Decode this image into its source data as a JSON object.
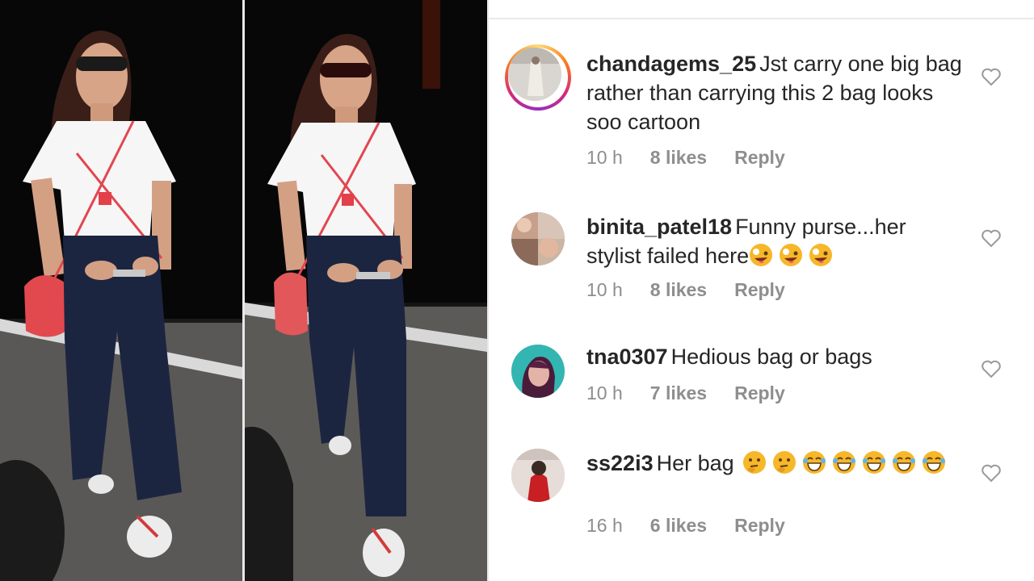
{
  "comments": [
    {
      "username": "chandagems_25",
      "text": "Jst carry one big bag rather than carrying this 2 bag looks soo cartoon",
      "emoji": [],
      "time": "10 h",
      "likes": "8 likes",
      "reply": "Reply",
      "has_story_ring": true,
      "avatar_icon": "user-avatar"
    },
    {
      "username": "binita_patel18",
      "text": "Funny purse...her stylist failed here",
      "emoji": [
        "zany-face",
        "zany-face",
        "zany-face"
      ],
      "time": "10 h",
      "likes": "8 likes",
      "reply": "Reply",
      "has_story_ring": false,
      "avatar_icon": "user-avatar"
    },
    {
      "username": "tna0307",
      "text": "Hedious bag or bags",
      "emoji": [],
      "time": "10 h",
      "likes": "7 likes",
      "reply": "Reply",
      "has_story_ring": false,
      "avatar_icon": "user-avatar"
    },
    {
      "username": "ss22i3",
      "text": "Her bag",
      "emoji": [
        "thinking-face",
        "thinking-face",
        "laughing-face",
        "laughing-face",
        "laughing-face",
        "laughing-face",
        "laughing-face"
      ],
      "time": "16 h",
      "likes": "6 likes",
      "reply": "Reply",
      "has_story_ring": false,
      "avatar_icon": "user-avatar"
    }
  ],
  "like_icon": "heart-outline-icon",
  "colors": {
    "text": "#262626",
    "meta": "#8e8e8e",
    "story_ring": [
      "#feda75",
      "#fa7e1e",
      "#d62976",
      "#962fbf"
    ]
  }
}
